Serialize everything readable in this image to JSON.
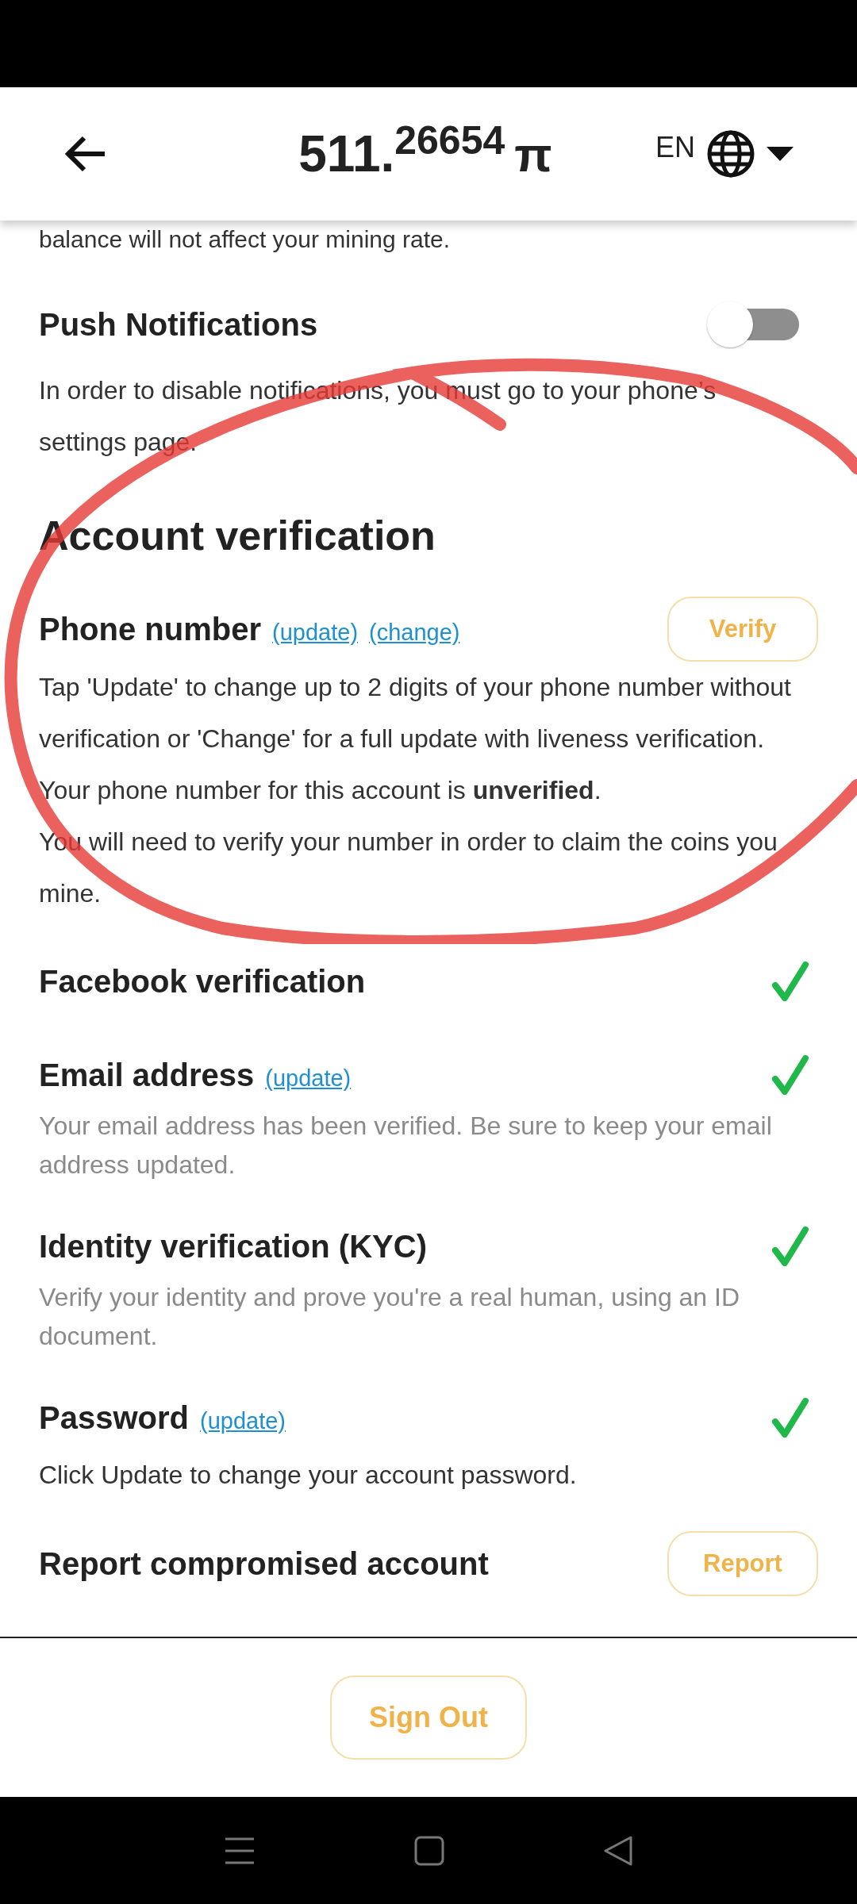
{
  "header": {
    "balance_integer": "511.",
    "balance_decimals": "26654",
    "currency_symbol": "π",
    "language": "EN"
  },
  "top_note": "balance will not affect your mining rate.",
  "push_notifications": {
    "title": "Push Notifications",
    "on": false,
    "description": "In order to disable notifications, you must go to your phone’s settings page."
  },
  "account_verification": {
    "title": "Account verification",
    "items": [
      {
        "kind": "action",
        "title": "Phone number",
        "links": [
          "(update)",
          "(change)"
        ],
        "button": "Verify",
        "muted": false,
        "paragraphs": [
          "Tap 'Update' to change up to 2 digits of your phone number without verification or 'Change' for a full update with liveness verification.",
          "Your phone number for this account is **unverified**.",
          "You will need to verify your number in order to claim the coins you mine."
        ]
      },
      {
        "kind": "status",
        "title": "Facebook verification",
        "verified": true
      },
      {
        "kind": "status",
        "title": "Email address",
        "links": [
          "(update)"
        ],
        "verified": true,
        "muted": true,
        "paragraphs": [
          "Your email address has been verified. Be sure to keep your email address updated."
        ]
      },
      {
        "kind": "status",
        "title": "Identity verification (KYC)",
        "verified": true,
        "muted": true,
        "paragraphs": [
          "Verify your identity and prove you're a real human, using an ID document."
        ]
      },
      {
        "kind": "status",
        "title": "Password",
        "links": [
          "(update)"
        ],
        "verified": true,
        "muted": false,
        "paragraphs": [
          "Click Update to change your account password."
        ]
      },
      {
        "kind": "action",
        "title": "Report compromised account",
        "button": "Report"
      }
    ]
  },
  "sign_out": "Sign Out"
}
